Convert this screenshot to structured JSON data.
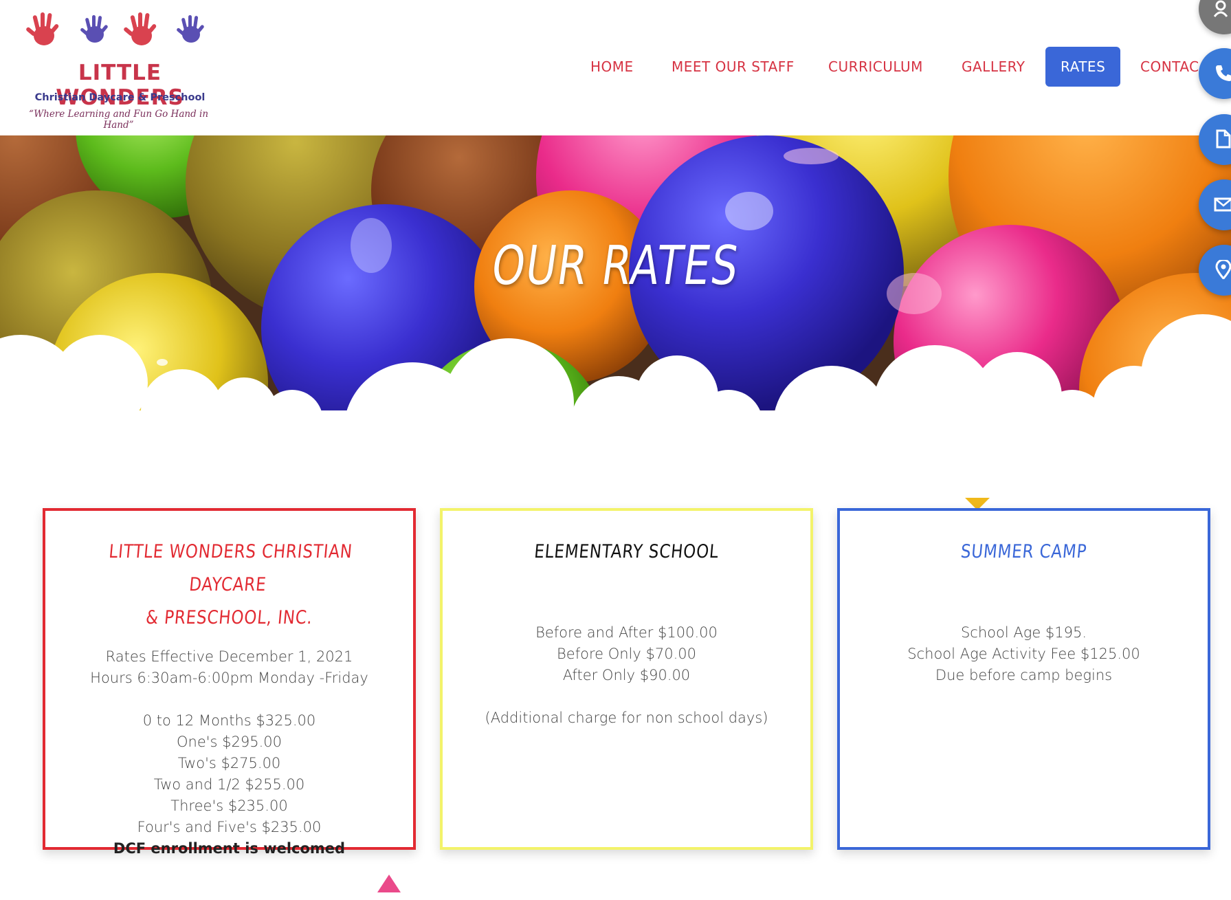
{
  "logo": {
    "title": "LITTLE WONDERS",
    "subtitle": "Christian Daycare & Preschool",
    "tagline": "“Where Learning and Fun Go Hand in Hand”"
  },
  "nav": {
    "items": [
      "HOME",
      "MEET OUR STAFF",
      "CURRICULUM",
      "GALLERY",
      "RATES",
      "CONTAC"
    ],
    "active": "RATES"
  },
  "hero": {
    "title": "OUR RATES"
  },
  "side_buttons": [
    "user-icon",
    "phone-icon",
    "document-icon",
    "mail-icon",
    "location-icon"
  ],
  "colors": {
    "accent_red": "#d63343",
    "accent_blue": "#3a67d8",
    "accent_yellow": "#f3f36a"
  },
  "cards": [
    {
      "title_line1": "LITTLE WONDERS CHRISTIAN DAYCARE",
      "title_line2": "& PRESCHOOL, INC.",
      "lines": [
        "Rates Effective December 1, 2021",
        "Hours 6:30am-6:00pm Monday -Friday"
      ],
      "rates": [
        "0 to 12 Months $325.00",
        "One's $295.00",
        "Two's $275.00",
        "Two and 1/2 $255.00",
        "Three's $235.00",
        "Four's and Five's $235.00"
      ],
      "note": "DCF enrollment is welcomed"
    },
    {
      "title": "ELEMENTARY SCHOOL",
      "rates": [
        "Before and After $100.00",
        "Before Only $70.00",
        "After Only $90.00"
      ],
      "note": "(Additional charge for non school days)"
    },
    {
      "title": "SUMMER CAMP",
      "lines": [
        "School Age $195.",
        "School Age Activity Fee $125.00",
        "Due before camp begins"
      ]
    }
  ]
}
